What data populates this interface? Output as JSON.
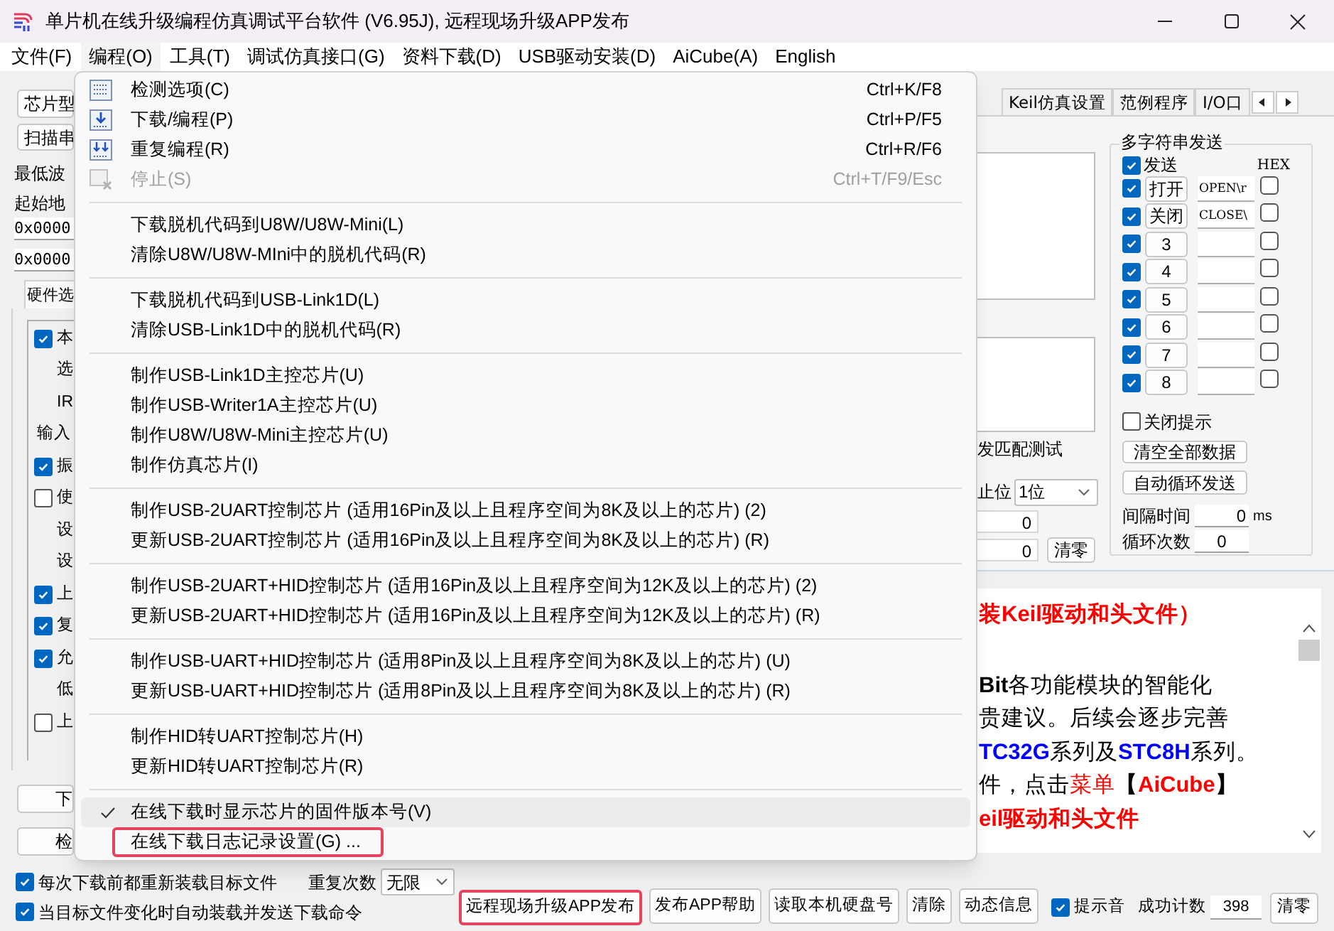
{
  "window": {
    "title": "单片机在线升级编程仿真调试平台软件 (V6.95J), 远程现场升级APP发布"
  },
  "menubar": [
    {
      "label": "文件(F)",
      "selected": false
    },
    {
      "label": "编程(O)",
      "selected": true
    },
    {
      "label": "工具(T)",
      "selected": false
    },
    {
      "label": "调试仿真接口(G)",
      "selected": false
    },
    {
      "label": "资料下载(D)",
      "selected": false
    },
    {
      "label": "USB驱动安装(D)",
      "selected": false
    },
    {
      "label": "AiCube(A)",
      "selected": false
    },
    {
      "label": "English",
      "selected": false
    }
  ],
  "left_panel": {
    "chip_button": "芯片型",
    "scan_button": "扫描串",
    "min_baud_label": "最低波",
    "start_address_label": "起始地",
    "address_fields": [
      "0x0000",
      "0x0000"
    ],
    "hardware_tab": "硬件选",
    "options": [
      {
        "kind": "checkbox",
        "label": "本",
        "checked": true
      },
      {
        "kind": "text",
        "label": "选"
      },
      {
        "kind": "text",
        "label": "IR"
      },
      {
        "kind": "heading",
        "label": "输入"
      },
      {
        "kind": "checkbox",
        "label": "振",
        "checked": true
      },
      {
        "kind": "checkbox",
        "label": "使",
        "checked": false
      },
      {
        "kind": "text",
        "label": "设"
      },
      {
        "kind": "text",
        "label": "设"
      },
      {
        "kind": "checkbox",
        "label": "上",
        "checked": true
      },
      {
        "kind": "checkbox",
        "label": "复",
        "checked": true
      },
      {
        "kind": "checkbox",
        "label": "允",
        "checked": true
      },
      {
        "kind": "text",
        "label": "低"
      },
      {
        "kind": "checkbox",
        "label": "上",
        "checked": false
      }
    ],
    "buttons": [
      "下",
      "检"
    ]
  },
  "tabs": [
    {
      "label": "Keil仿真设置",
      "selected": false
    },
    {
      "label": "范例程序",
      "selected": false
    },
    {
      "label": "I/O口",
      "selected": false
    }
  ],
  "serial_panel": {
    "match_test_label": "发匹配测试",
    "stop_bits_label": "止位",
    "stop_bits": "1位",
    "counters": [
      "0",
      "0"
    ],
    "clear_button": "清零"
  },
  "multi_send": {
    "title": "多字符串发送",
    "send_label": "发送",
    "send_checked": true,
    "hex_label": "HEX",
    "rows": [
      {
        "checked": true,
        "button": "打开",
        "value": "OPEN\\r",
        "hex": false
      },
      {
        "checked": true,
        "button": "关闭",
        "value": "CLOSE\\",
        "hex": false
      },
      {
        "checked": true,
        "button": "3",
        "value": "",
        "hex": false
      },
      {
        "checked": true,
        "button": "4",
        "value": "",
        "hex": false
      },
      {
        "checked": true,
        "button": "5",
        "value": "",
        "hex": false
      },
      {
        "checked": true,
        "button": "6",
        "value": "",
        "hex": false
      },
      {
        "checked": true,
        "button": "7",
        "value": "",
        "hex": false
      },
      {
        "checked": true,
        "button": "8",
        "value": "",
        "hex": false
      }
    ],
    "close_prompt": {
      "label": "关闭提示",
      "checked": false
    },
    "clear_all_button": "清空全部数据",
    "auto_loop_button": "自动循环发送",
    "interval_label": "间隔时间",
    "interval": "0",
    "interval_unit": "ms",
    "loop_count_label": "循环次数",
    "loop_count": "0"
  },
  "info_text": {
    "paragraphs": [
      {
        "lines": [
          [
            {
              "text": "装Keil驱动和头文件）",
              "color": "#ff0000",
              "bold": true
            }
          ]
        ]
      },
      {
        "lines": [
          [
            {
              "text": "Bit",
              "color": "#000000",
              "bold": true
            },
            {
              "text": "各功能模块的智能化",
              "color": "#000000",
              "bold": false
            }
          ],
          [
            {
              "text": "贵建议。后续会逐步完善",
              "color": "#000000",
              "bold": false
            }
          ],
          [
            {
              "text": "TC32G",
              "color": "#0000ff",
              "bold": true
            },
            {
              "text": "系列及",
              "color": "#000000",
              "bold": false
            },
            {
              "text": "STC8H",
              "color": "#0000ff",
              "bold": true
            },
            {
              "text": "系列。",
              "color": "#000000",
              "bold": false
            }
          ],
          [
            {
              "text": "件，点击",
              "color": "#000000",
              "bold": false
            },
            {
              "text": "菜单",
              "color": "#ff0000",
              "bold": false
            },
            {
              "text": "【",
              "color": "#000000",
              "bold": true
            },
            {
              "text": "AiCube",
              "color": "#ff0000",
              "bold": true
            },
            {
              "text": "】",
              "color": "#000000",
              "bold": true
            }
          ],
          [
            {
              "text": "eil驱动和头文件",
              "color": "#ff0000",
              "bold": true
            }
          ]
        ]
      }
    ]
  },
  "bottom_bar": {
    "reload_before_download": {
      "label": "每次下载前都重新装载目标文件",
      "checked": true
    },
    "auto_reload": {
      "label": "当目标文件变化时自动装载并发送下载命令",
      "checked": true
    },
    "repeat_label": "重复次数",
    "repeat": "无限",
    "buttons": [
      {
        "label": "远程现场升级APP发布",
        "outlined": true
      },
      {
        "label": "发布APP帮助",
        "outlined": false
      },
      {
        "label": "读取本机硬盘号",
        "outlined": false
      },
      {
        "label": "清除",
        "outlined": false
      },
      {
        "label": "动态信息",
        "outlined": false
      }
    ],
    "sound": {
      "label": "提示音",
      "checked": true
    },
    "success_label": "成功计数",
    "success_count": "398",
    "clear_button": "清零"
  },
  "program_menu": {
    "groups": [
      [
        {
          "kind": "options",
          "label": "检测选项(C)",
          "shortcut": "Ctrl+K/F8",
          "disabled": false,
          "checked": false,
          "highlighted": false,
          "outlined": false
        },
        {
          "kind": "download",
          "label": "下载/编程(P)",
          "shortcut": "Ctrl+P/F5",
          "disabled": false,
          "checked": false,
          "highlighted": false,
          "outlined": false
        },
        {
          "kind": "repeat",
          "label": "重复编程(R)",
          "shortcut": "Ctrl+R/F6",
          "disabled": false,
          "checked": false,
          "highlighted": false,
          "outlined": false
        },
        {
          "kind": "stop",
          "label": "停止(S)",
          "shortcut": "Ctrl+T/F9/Esc",
          "disabled": true,
          "checked": false,
          "highlighted": false,
          "outlined": false
        }
      ],
      [
        {
          "kind": "plain",
          "label": "下载脱机代码到U8W/U8W-Mini(L)",
          "disabled": false,
          "checked": false,
          "highlighted": false,
          "outlined": false
        },
        {
          "kind": "plain",
          "label": "清除U8W/U8W-MIni中的脱机代码(R)",
          "disabled": false,
          "checked": false,
          "highlighted": false,
          "outlined": false
        }
      ],
      [
        {
          "kind": "plain",
          "label": "下载脱机代码到USB-Link1D(L)",
          "disabled": false,
          "checked": false,
          "highlighted": false,
          "outlined": false
        },
        {
          "kind": "plain",
          "label": "清除USB-Link1D中的脱机代码(R)",
          "disabled": false,
          "checked": false,
          "highlighted": false,
          "outlined": false
        }
      ],
      [
        {
          "kind": "plain",
          "label": "制作USB-Link1D主控芯片(U)",
          "disabled": false,
          "checked": false,
          "highlighted": false,
          "outlined": false
        },
        {
          "kind": "plain",
          "label": "制作USB-Writer1A主控芯片(U)",
          "disabled": false,
          "checked": false,
          "highlighted": false,
          "outlined": false
        },
        {
          "kind": "plain",
          "label": "制作U8W/U8W-Mini主控芯片(U)",
          "disabled": false,
          "checked": false,
          "highlighted": false,
          "outlined": false
        },
        {
          "kind": "plain",
          "label": "制作仿真芯片(I)",
          "disabled": false,
          "checked": false,
          "highlighted": false,
          "outlined": false
        }
      ],
      [
        {
          "kind": "plain",
          "label": "制作USB-2UART控制芯片 (适用16Pin及以上且程序空间为8K及以上的芯片) (2)",
          "disabled": false,
          "checked": false,
          "highlighted": false,
          "outlined": false
        },
        {
          "kind": "plain",
          "label": "更新USB-2UART控制芯片 (适用16Pin及以上且程序空间为8K及以上的芯片) (R)",
          "disabled": false,
          "checked": false,
          "highlighted": false,
          "outlined": false
        }
      ],
      [
        {
          "kind": "plain",
          "label": "制作USB-2UART+HID控制芯片 (适用16Pin及以上且程序空间为12K及以上的芯片) (2)",
          "disabled": false,
          "checked": false,
          "highlighted": false,
          "outlined": false
        },
        {
          "kind": "plain",
          "label": "更新USB-2UART+HID控制芯片 (适用16Pin及以上且程序空间为12K及以上的芯片) (R)",
          "disabled": false,
          "checked": false,
          "highlighted": false,
          "outlined": false
        }
      ],
      [
        {
          "kind": "plain",
          "label": "制作USB-UART+HID控制芯片 (适用8Pin及以上且程序空间为8K及以上的芯片) (U)",
          "disabled": false,
          "checked": false,
          "highlighted": false,
          "outlined": false
        },
        {
          "kind": "plain",
          "label": "更新USB-UART+HID控制芯片 (适用8Pin及以上且程序空间为8K及以上的芯片) (R)",
          "disabled": false,
          "checked": false,
          "highlighted": false,
          "outlined": false
        }
      ],
      [
        {
          "kind": "plain",
          "label": "制作HID转UART控制芯片(H)",
          "disabled": false,
          "checked": false,
          "highlighted": false,
          "outlined": false
        },
        {
          "kind": "plain",
          "label": "更新HID转UART控制芯片(R)",
          "disabled": false,
          "checked": false,
          "highlighted": false,
          "outlined": false
        }
      ],
      [
        {
          "kind": "plain",
          "label": "在线下载时显示芯片的固件版本号(V)",
          "disabled": false,
          "checked": true,
          "highlighted": true,
          "outlined": false
        },
        {
          "kind": "plain",
          "label": "在线下载日志记录设置(G) ...",
          "disabled": false,
          "checked": false,
          "highlighted": false,
          "outlined": true
        }
      ]
    ]
  }
}
